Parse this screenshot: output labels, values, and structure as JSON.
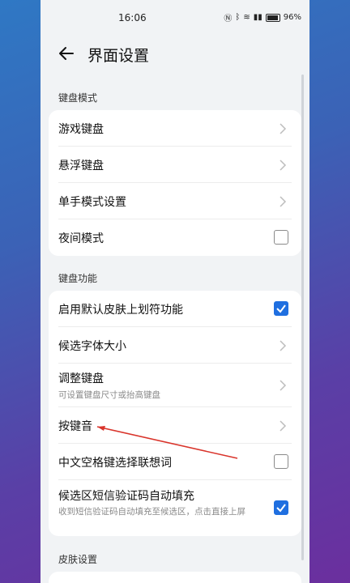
{
  "status": {
    "time": "16:06",
    "battery": "96%",
    "icons": [
      "nfc-icon",
      "bluetooth-icon",
      "wifi-icon",
      "signal-icon",
      "battery-icon"
    ]
  },
  "header": {
    "title": "界面设置"
  },
  "sections": [
    {
      "title": "键盘模式",
      "items": [
        {
          "label": "游戏键盘",
          "control": "chevron"
        },
        {
          "label": "悬浮键盘",
          "control": "chevron"
        },
        {
          "label": "单手模式设置",
          "control": "chevron"
        },
        {
          "label": "夜间模式",
          "control": "checkbox",
          "checked": false
        }
      ]
    },
    {
      "title": "键盘功能",
      "items": [
        {
          "label": "启用默认皮肤上划符功能",
          "control": "checkbox",
          "checked": true
        },
        {
          "label": "候选字体大小",
          "control": "chevron"
        },
        {
          "label": "调整键盘",
          "sub": "可设置键盘尺寸或抬高键盘",
          "control": "chevron"
        },
        {
          "label": "按键音",
          "control": "chevron"
        },
        {
          "label": "中文空格键选择联想词",
          "control": "checkbox",
          "checked": false
        },
        {
          "label": "候选区短信验证码自动填充",
          "sub": "收到短信验证码自动填充至候选区，点击直接上屏",
          "control": "checkbox",
          "checked": true
        }
      ]
    },
    {
      "title": "皮肤设置",
      "items": []
    }
  ],
  "colors": {
    "accent": "#1f6fe0",
    "annotation": "#d9342b"
  }
}
